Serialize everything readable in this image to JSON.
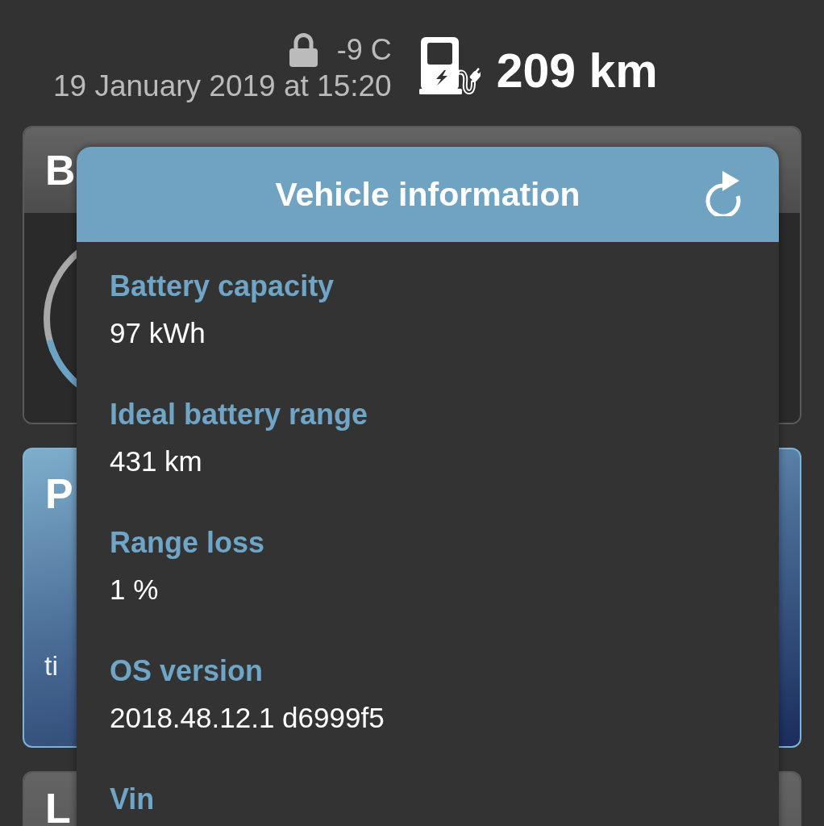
{
  "status": {
    "locked": true,
    "temperature": "-9 C",
    "timestamp": "19 January 2019 at 15:20",
    "range": "209 km"
  },
  "cards": [
    {
      "kind": "gauge",
      "title": "B"
    },
    {
      "kind": "highlight",
      "title": "P",
      "caption": "ti"
    },
    {
      "kind": "plain",
      "title": "L"
    }
  ],
  "dialog": {
    "title": "Vehicle information",
    "fields": [
      {
        "label": "Battery capacity",
        "value": "97 kWh"
      },
      {
        "label": "Ideal battery range",
        "value": "431 km"
      },
      {
        "label": "Range loss",
        "value": "1 %"
      },
      {
        "label": "OS version",
        "value": "2018.48.12.1 d6999f5"
      },
      {
        "label": "Vin"
      }
    ]
  }
}
